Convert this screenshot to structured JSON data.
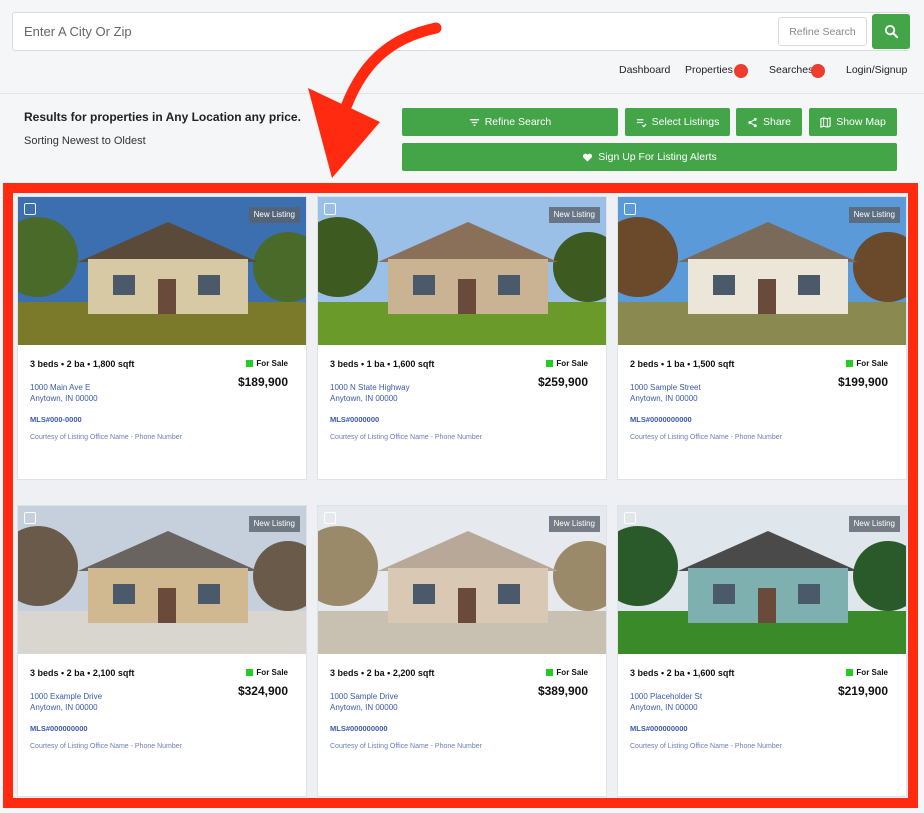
{
  "header": {
    "search_placeholder": "Enter A City Or Zip",
    "refine_label": "Refine Search",
    "nav": {
      "dashboard": "Dashboard",
      "properties": "Properties",
      "searches": "Searches",
      "login": "Login/Signup"
    }
  },
  "results": {
    "title": "Results for properties in Any Location any price.",
    "sorting": "Sorting Newest to Oldest"
  },
  "actions": {
    "refine": "Refine Search",
    "select": "Select Listings",
    "share": "Share",
    "map": "Show Map",
    "alerts": "Sign Up For Listing Alerts"
  },
  "colors": {
    "accent_green": "#43a548",
    "annotation_red": "#ff2a10",
    "badge_red": "#f03b2f"
  },
  "listings": [
    {
      "tag": "New Listing",
      "specs": "3 beds • 2 ba • 1,800 sqft",
      "status": "For Sale",
      "price": "$189,900",
      "addr1": "1000 Main Ave E",
      "addr2": "Anytown, IN 00000",
      "mls": "MLS#000-0000",
      "desc": "Courtesy of Listing Office Name - Phone Number"
    },
    {
      "tag": "New Listing",
      "specs": "3 beds • 1 ba • 1,600 sqft",
      "status": "For Sale",
      "price": "$259,900",
      "addr1": "1000 N State Highway",
      "addr2": "Anytown, IN 00000",
      "mls": "MLS#0000000",
      "desc": "Courtesy of Listing Office Name - Phone Number"
    },
    {
      "tag": "New Listing",
      "specs": "2 beds • 1 ba • 1,500 sqft",
      "status": "For Sale",
      "price": "$199,900",
      "addr1": "1000 Sample Street",
      "addr2": "Anytown, IN 00000",
      "mls": "MLS#0000000000",
      "desc": "Courtesy of Listing Office Name - Phone Number"
    },
    {
      "tag": "New Listing",
      "specs": "3 beds • 2 ba • 2,100 sqft",
      "status": "For Sale",
      "price": "$324,900",
      "addr1": "1000 Example Drive",
      "addr2": "Anytown, IN 00000",
      "mls": "MLS#000000000",
      "desc": "Courtesy of Listing Office Name - Phone Number"
    },
    {
      "tag": "New Listing",
      "specs": "3 beds • 2 ba • 2,200 sqft",
      "status": "For Sale",
      "price": "$389,900",
      "addr1": "1000 Sample Drive",
      "addr2": "Anytown, IN 00000",
      "mls": "MLS#000000000",
      "desc": "Courtesy of Listing Office Name - Phone Number"
    },
    {
      "tag": "New Listing",
      "specs": "3 beds • 2 ba • 1,600 sqft",
      "status": "For Sale",
      "price": "$219,900",
      "addr1": "1000 Placeholder St",
      "addr2": "Anytown, IN 00000",
      "mls": "MLS#000000000",
      "desc": "Courtesy of Listing Office Name - Phone Number"
    }
  ]
}
